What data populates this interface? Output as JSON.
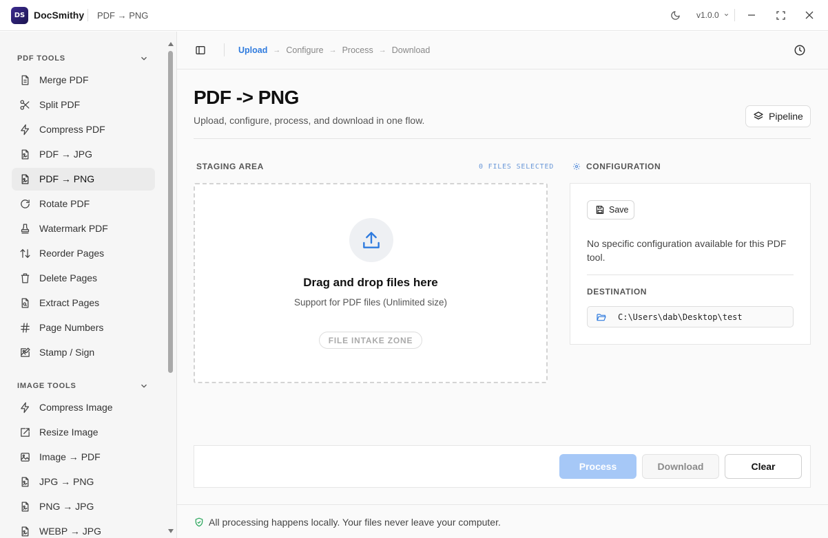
{
  "app": {
    "logo_text": "DS",
    "name": "DocSmithy",
    "current_page": "PDF → PNG",
    "version": "v1.0.0"
  },
  "sidebar": {
    "sections": [
      {
        "title": "PDF TOOLS",
        "items": [
          {
            "label": "Merge PDF",
            "icon": "file-text-icon"
          },
          {
            "label": "Split PDF",
            "icon": "scissors-icon"
          },
          {
            "label": "Compress PDF",
            "icon": "lightning-icon"
          },
          {
            "label": "PDF → JPG",
            "icon": "file-image-icon"
          },
          {
            "label": "PDF → PNG",
            "icon": "file-image-icon",
            "active": true
          },
          {
            "label": "Rotate PDF",
            "icon": "rotate-icon"
          },
          {
            "label": "Watermark PDF",
            "icon": "stamp-icon"
          },
          {
            "label": "Reorder Pages",
            "icon": "sort-arrows-icon"
          },
          {
            "label": "Delete Pages",
            "icon": "trash-icon"
          },
          {
            "label": "Extract Pages",
            "icon": "file-search-icon"
          },
          {
            "label": "Page Numbers",
            "icon": "hash-icon"
          },
          {
            "label": "Stamp / Sign",
            "icon": "image-edit-icon"
          }
        ]
      },
      {
        "title": "IMAGE TOOLS",
        "items": [
          {
            "label": "Compress Image",
            "icon": "lightning-icon"
          },
          {
            "label": "Resize Image",
            "icon": "resize-icon"
          },
          {
            "label": "Image → PDF",
            "icon": "image-icon"
          },
          {
            "label": "JPG → PNG",
            "icon": "file-image-icon"
          },
          {
            "label": "PNG → JPG",
            "icon": "file-image-icon"
          },
          {
            "label": "WEBP → JPG",
            "icon": "file-image-icon"
          }
        ]
      }
    ]
  },
  "breadcrumb": {
    "steps": [
      "Upload",
      "Configure",
      "Process",
      "Download"
    ],
    "active_step": "Upload"
  },
  "page": {
    "title": "PDF -> PNG",
    "subtitle": "Upload, configure, process, and download in one flow.",
    "pipeline_label": "Pipeline"
  },
  "staging": {
    "label": "STAGING AREA",
    "files_selected": "0 FILES SELECTED",
    "drop_title": "Drag and drop files here",
    "drop_subtitle": "Support for PDF files (Unlimited size)",
    "zone_badge": "FILE INTAKE ZONE"
  },
  "config": {
    "label": "CONFIGURATION",
    "save_label": "Save",
    "message": "No specific configuration available for this PDF tool.",
    "destination_label": "DESTINATION",
    "destination_path": "C:\\Users\\dab\\Desktop\\test"
  },
  "actions": {
    "process": "Process",
    "download": "Download",
    "clear": "Clear"
  },
  "footer": {
    "text": "All processing happens locally. Your files never leave your computer."
  },
  "colors": {
    "accent": "#2f7bde",
    "process_disabled": "#a6c8f7",
    "secure_green": "#2fa860"
  }
}
